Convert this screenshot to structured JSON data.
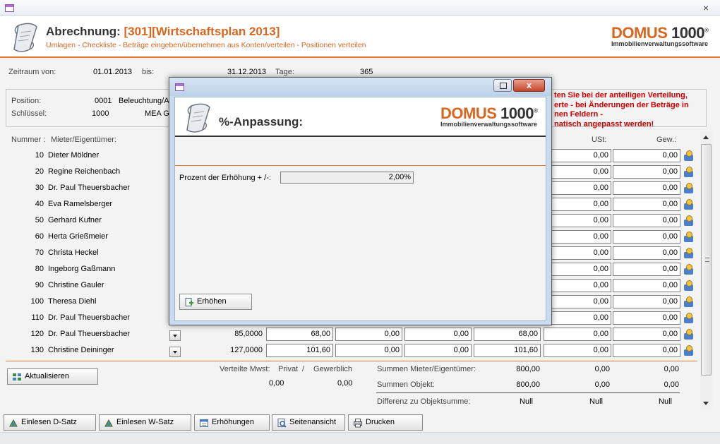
{
  "header": {
    "title_prefix": "Abrechnung:",
    "title_value": "[301][Wirtschaftsplan 2013]",
    "subtitle": "Umlagen - Checkliste - Beträge eingeben/übernehmen aus Konten/verteilen - Positionen verteilen",
    "logo_main": "DOMUS 1000",
    "logo_reg": "®",
    "logo_sub": "Immobilienverwaltungssoftware"
  },
  "period": {
    "from_label": "Zeitraum von:",
    "from_value": "01.01.2013",
    "to_label": "bis:",
    "to_value": "31.12.2013",
    "days_label": "Tage:",
    "days_value": "365"
  },
  "position": {
    "label": "Position:",
    "number": "0001",
    "name": "Beleuchtung/A",
    "key_label": "Schlüssel:",
    "key_value": "1000",
    "key_name": "MEA G"
  },
  "warning": [
    "ten Sie bei der anteiligen Verteilung,",
    "erte - bei Änderungen der Beträge in",
    "nen Feldern -",
    "natisch angepasst werden!"
  ],
  "columns": {
    "nummer": "Nummer :",
    "mieter": "Mieter/Eigentümer:",
    "ust": "USt:",
    "gew": "Gew.:"
  },
  "rows": [
    {
      "num": "10",
      "name": "Dieter Möldner",
      "ust": "0,00",
      "gew": "0,00"
    },
    {
      "num": "20",
      "name": "Regine Reichenbach",
      "ust": "0,00",
      "gew": "0,00"
    },
    {
      "num": "30",
      "name": "Dr. Paul Theuersbacher",
      "ust": "0,00",
      "gew": "0,00"
    },
    {
      "num": "40",
      "name": "Eva Ramelsberger",
      "ust": "0,00",
      "gew": "0,00"
    },
    {
      "num": "50",
      "name": "Gerhard Kufner",
      "ust": "0,00",
      "gew": "0,00"
    },
    {
      "num": "60",
      "name": "Herta Grießmeier",
      "ust": "0,00",
      "gew": "0,00"
    },
    {
      "num": "70",
      "name": "Christa Heckel",
      "ust": "0,00",
      "gew": "0,00"
    },
    {
      "num": "80",
      "name": "Ingeborg Gaßmann",
      "ust": "0,00",
      "gew": "0,00"
    },
    {
      "num": "90",
      "name": "Christine Gauler",
      "ust": "0,00",
      "gew": "0,00"
    },
    {
      "num": "100",
      "name": "Theresa Diehl",
      "ust": "0,00",
      "gew": "0,00"
    },
    {
      "num": "110",
      "name": "Dr. Paul Theuersbacher",
      "ust": "0,00",
      "gew": "0,00"
    },
    {
      "num": "120",
      "name": "Dr. Paul Theuersbacher",
      "mea": "85,0000",
      "c1": "68,00",
      "c2": "0,00",
      "c3": "0,00",
      "c4": "68,00",
      "ust": "0,00",
      "gew": "0,00"
    },
    {
      "num": "130",
      "name": "Christine Deininger",
      "mea": "127,0000",
      "c1": "101,60",
      "c2": "0,00",
      "c3": "0,00",
      "c4": "101,60",
      "ust": "0,00",
      "gew": "0,00"
    }
  ],
  "footer": {
    "aktualisieren": "Aktualisieren",
    "verteilte_label": "Verteilte Mwst:",
    "privat_label": "Privat",
    "slash": "/",
    "gewerblich_label": "Gewerblich",
    "privat_value": "0,00",
    "gewerblich_value": "0,00",
    "summen_mieter_label": "Summen Mieter/Eigentümer:",
    "summen_mieter_values": [
      "800,00",
      "0,00",
      "0,00"
    ],
    "summen_objekt_label": "Summen Objekt:",
    "summen_objekt_values": [
      "800,00",
      "0,00",
      "0,00"
    ],
    "differenz_label": "Differenz zu Objektsumme:",
    "differenz_values": [
      "Null",
      "Null",
      "Null"
    ]
  },
  "bottom_buttons": {
    "einlesen_d": "Einlesen D-Satz",
    "einlesen_w": "Einlesen W-Satz",
    "erhoehungen": "Erhöhungen",
    "seitenansicht": "Seitenansicht",
    "drucken": "Drucken"
  },
  "modal": {
    "title": "%-Anpassung:",
    "close": "x",
    "field_label": "Prozent der Erhöhung  + /-:",
    "field_value": "2,00%",
    "button": "Erhöhen"
  },
  "colors": {
    "accent": "#d9661f",
    "warning": "#d00000"
  }
}
